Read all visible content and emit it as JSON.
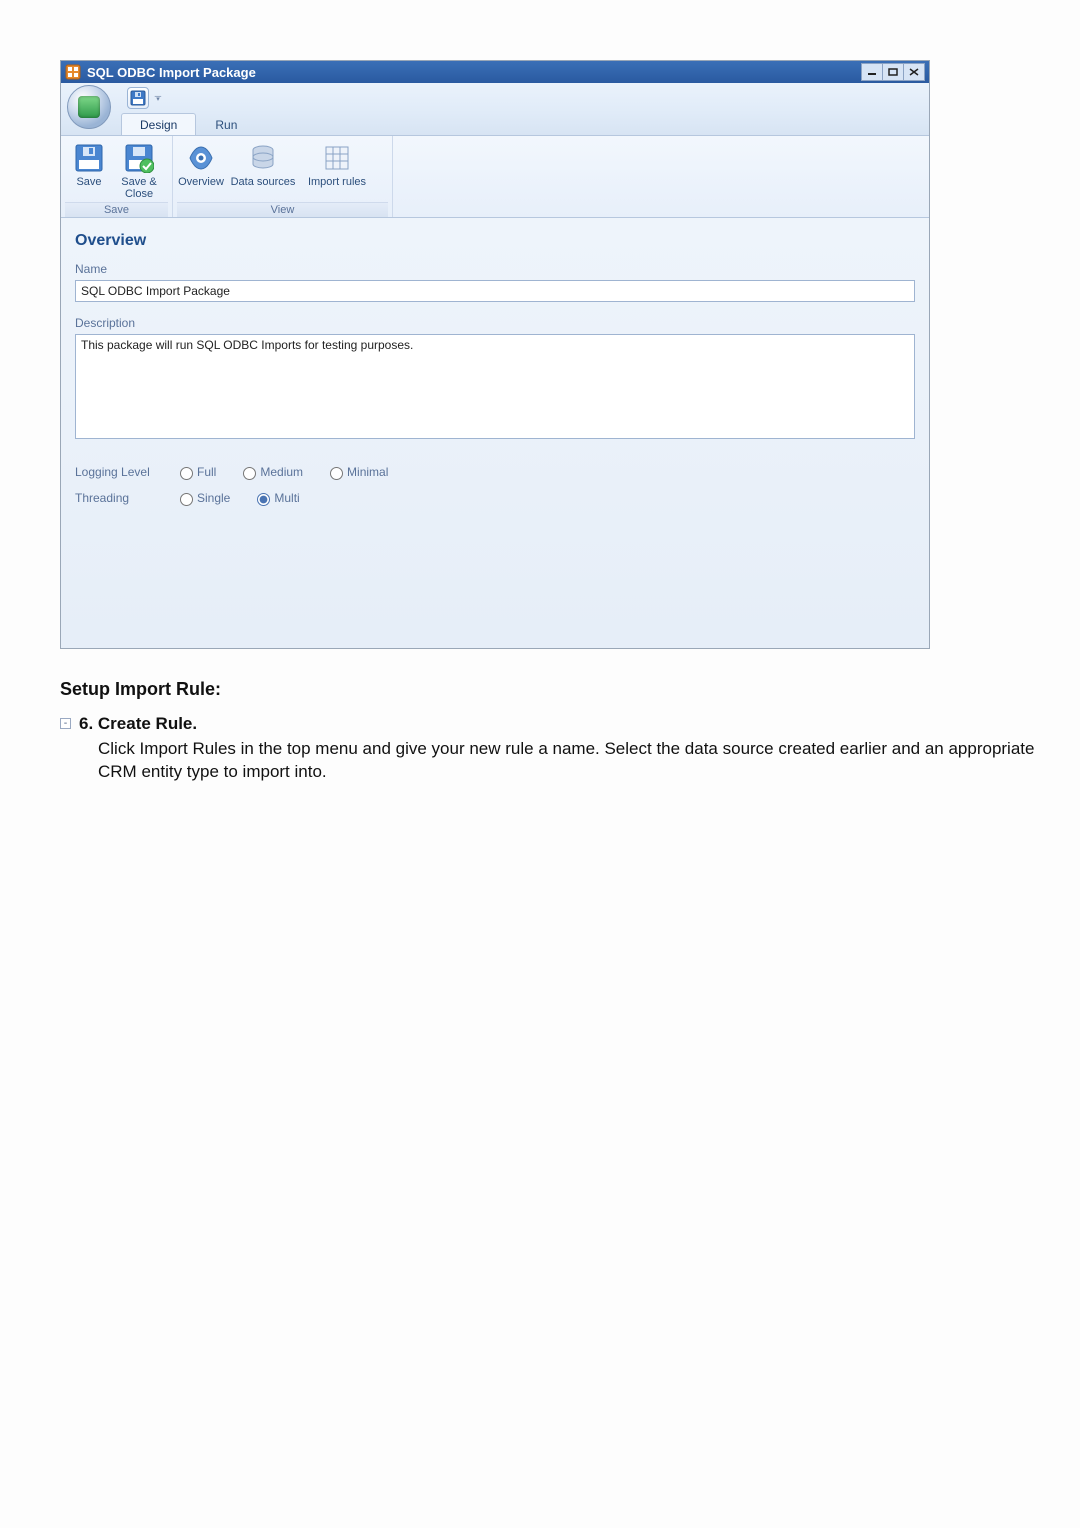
{
  "window": {
    "title": "SQL ODBC Import Package"
  },
  "tabs": {
    "design": "Design",
    "run": "Run"
  },
  "ribbon": {
    "save_group": {
      "save": "Save",
      "save_close_line1": "Save &",
      "save_close_line2": "Close",
      "caption": "Save"
    },
    "view_group": {
      "overview": "Overview",
      "data_sources": "Data sources",
      "import_rules": "Import rules",
      "caption": "View"
    }
  },
  "overview": {
    "title": "Overview",
    "name_label": "Name",
    "name_value": "SQL ODBC Import Package",
    "description_label": "Description",
    "description_value": "This package will run SQL ODBC Imports for testing purposes.",
    "logging_label": "Logging Level",
    "logging_options": {
      "full": "Full",
      "medium": "Medium",
      "minimal": "Minimal"
    },
    "threading_label": "Threading",
    "threading_options": {
      "single": "Single",
      "multi": "Multi"
    }
  },
  "doc": {
    "heading": "Setup Import Rule:",
    "step_title": "6. Create Rule.",
    "step_body": "Click Import Rules in the top menu and give your new rule a name.  Select the data source created earlier and an appropriate CRM entity type to import into."
  },
  "colors": {
    "titlebar": "#2f62aa",
    "accent_text": "#1f4e8c"
  }
}
